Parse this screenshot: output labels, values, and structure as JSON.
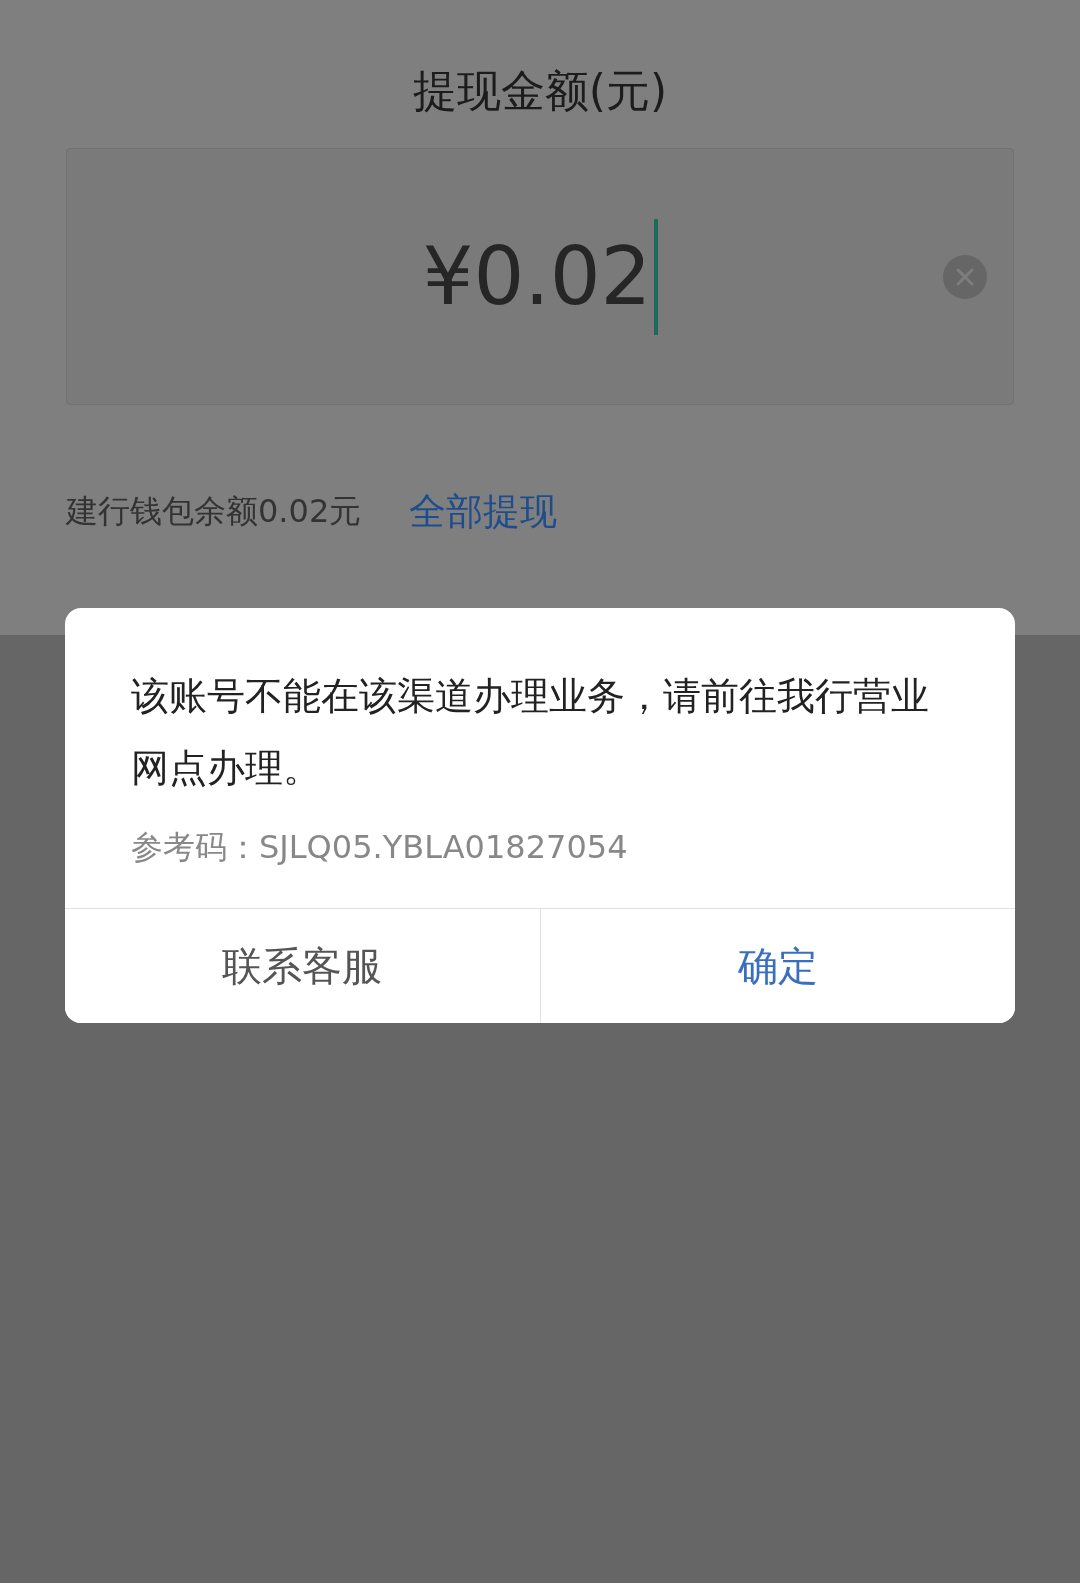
{
  "title": "提现金额(元)",
  "amount_field": {
    "value": "¥0.02",
    "focused": true
  },
  "balance": {
    "text": "建行钱包余额0.02元",
    "link": "全部提现"
  },
  "dialog": {
    "message": "该账号不能在该渠道办理业务，请前往我行营业网点办理。",
    "reference": "参考码：SJLQ05.YBLA01827054",
    "buttons": [
      {
        "label": "联系客服",
        "kind": "secondary"
      },
      {
        "label": "确定",
        "kind": "primary"
      }
    ]
  }
}
